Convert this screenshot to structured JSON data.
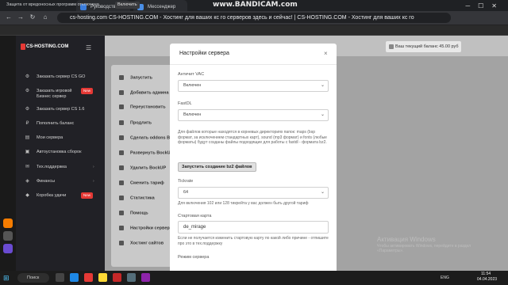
{
  "browser": {
    "tabs": [
      {
        "label": "Руководство",
        "color": "#3b7ddd"
      },
      {
        "label": "Мессенджер",
        "color": "#4a8fe7"
      }
    ],
    "watermark": "www.BANDICAM.com",
    "url": "cs-hosting.com   CS-HOSTING.COM - Хостинг для ваших кс го серверов здесь и сейчас! | CS-HOSTING.COM - Хостинг для ваших кс го",
    "notice_text": "Защита от вредоносных программ отключена",
    "notice_button": "Включить"
  },
  "site": {
    "logo": "CS-HOSTING.COM",
    "balance": "Ваш текущий баланс 45.00 руб",
    "sidebar": [
      {
        "label": "Заказать сервер CS GO",
        "icon": "⚙",
        "badge": "",
        "arrow": false
      },
      {
        "label": "Заказать игровой Бизнес сервер",
        "icon": "⚙",
        "badge": "New",
        "arrow": false
      },
      {
        "label": "Заказать сервер CS 1.6",
        "icon": "⚙",
        "badge": "",
        "arrow": false
      },
      {
        "label": "Пополнить баланс",
        "icon": "₽",
        "badge": "",
        "arrow": false
      },
      {
        "label": "Мои сервера",
        "icon": "▤",
        "badge": "",
        "arrow": false
      },
      {
        "label": "Автоустановка сборок",
        "icon": "▣",
        "badge": "",
        "arrow": false
      },
      {
        "label": "Тех.поддержка",
        "icon": "✉",
        "badge": "",
        "arrow": true
      },
      {
        "label": "Финансы",
        "icon": "◈",
        "badge": "",
        "arrow": true
      },
      {
        "label": "Коробка удачи",
        "icon": "◆",
        "badge": "New",
        "arrow": false
      }
    ],
    "panel_items": [
      "Запустить",
      "Добавить админа",
      "Переустановить",
      "Продлить",
      "Сделать oddons B",
      "Развернуть BockUP",
      "Удалить BockUP",
      "Сменить тариф",
      "Статистика",
      "Помощь",
      "Настройки сервера",
      "Хостинг сайтов"
    ],
    "windows_activation": {
      "title": "Активация Windows",
      "sub": "Чтобы активировать Windows, перейдите в раздел «Параметры»."
    }
  },
  "modal": {
    "title": "Настройки сервера",
    "close": "×",
    "vac_label": "Античит VAC",
    "vac_value": "Включен",
    "fastdl_label": "FastDL",
    "fastdl_value": "Включен",
    "fastdl_help": "Для файлов которые находятся в корневых директориях папок: maps (bsp формат, за исключением стандартных карт), sound (mp3 формат) и fonts (любые форматы) будут созданы файлы подходящие для работы с fastdl - формата bz2.",
    "bz2_button": "Запустить создание bz2 файлов",
    "tickrate_label": "Tickrate",
    "tickrate_value": "64",
    "tickrate_help": "Для включения 102 или 128 тикрейта у вас должен быть другой тариф",
    "map_label": "Стартовая карта",
    "map_value": "de_mirage",
    "map_help": "Если не получается изменить стартовую карту по какой либо причине - отпишите про это в тех.поддержку",
    "mode_label": "Режим сервера"
  },
  "taskbar": {
    "search": "Поиск",
    "lang": "ENG",
    "time": "11:54",
    "date": "04.04.2023"
  }
}
